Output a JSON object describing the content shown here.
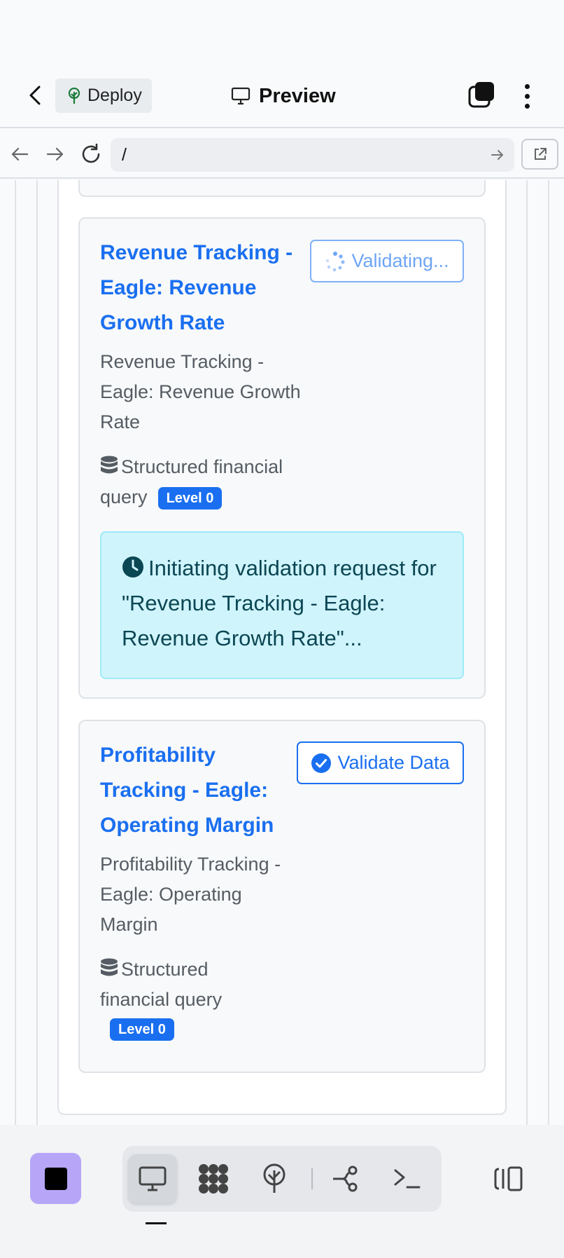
{
  "header": {
    "deploy_label": "Deploy",
    "title": "Preview"
  },
  "address_bar": {
    "url": "/"
  },
  "cards": [
    {
      "title": "Revenue Tracking - Eagle: Revenue Growth Rate",
      "description": "Revenue Tracking - Eagle: Revenue Growth Rate",
      "source": "Structured financial query",
      "level": "Level 0",
      "button_label": "Validating...",
      "status_message": "Initiating validation request for \"Revenue Tracking - Eagle: Revenue Growth Rate\"..."
    },
    {
      "title": "Profitability Tracking - Eagle: Operating Margin",
      "description": "Profitability Tracking - Eagle: Operating Margin",
      "source": "Structured financial query",
      "level": "Level 0",
      "button_label": "Validate Data"
    }
  ],
  "colors": {
    "accent": "#1a6ff0",
    "info_bg": "#cff4fc",
    "info_text": "#0b4653",
    "app_tile": "#b7a6f8"
  },
  "bottom_toolbar": {
    "active_tool": "preview"
  }
}
